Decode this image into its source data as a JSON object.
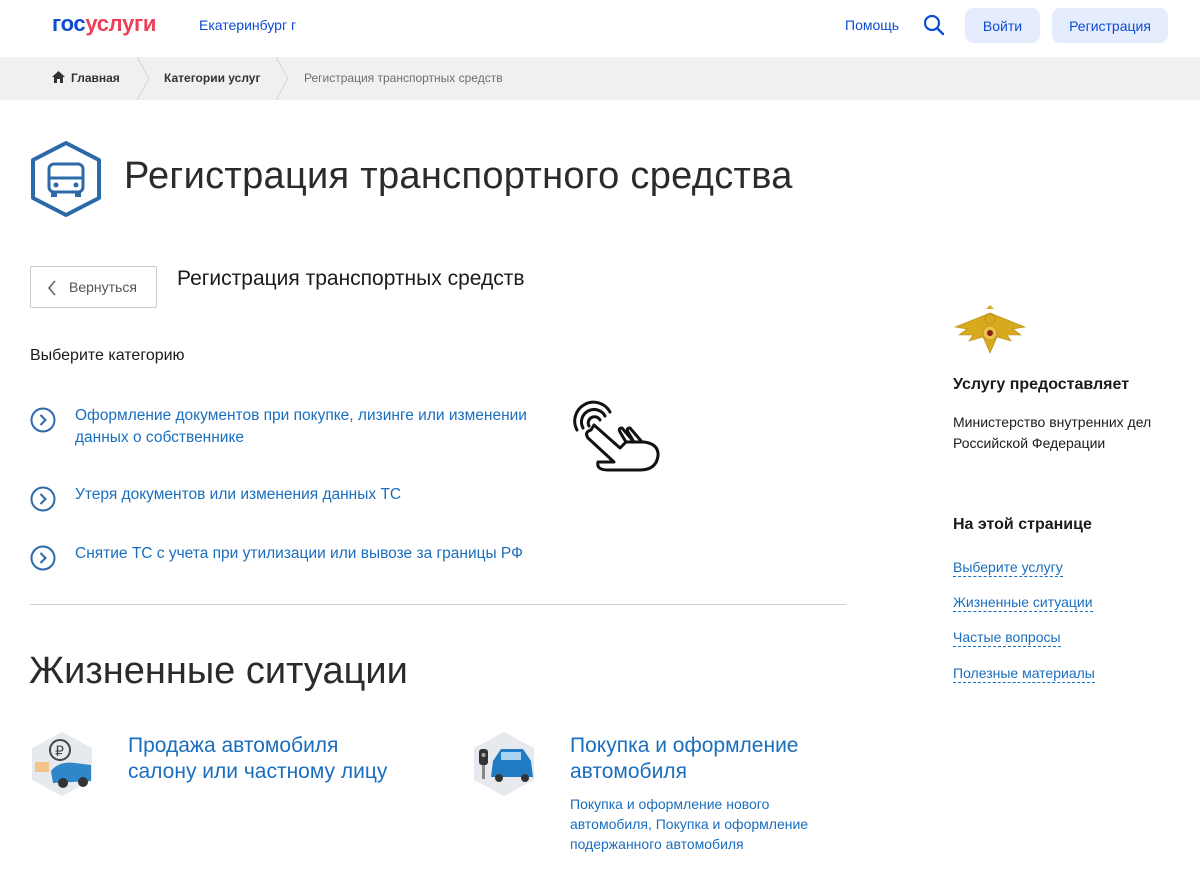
{
  "header": {
    "logo_part1": "гос",
    "logo_part2": "услуги",
    "city": "Екатеринбург г",
    "help": "Помощь",
    "login": "Войти",
    "register": "Регистрация"
  },
  "breadcrumbs": [
    "Главная",
    "Категории услуг",
    "Регистрация транспортных средств"
  ],
  "page": {
    "title": "Регистрация транспортного средства",
    "back": "Вернуться",
    "subtitle": "Регистрация транспортных средств",
    "choose_label": "Выберите категорию",
    "categories": [
      {
        "line1": "Оформление документов при покупке, лизинге или изменении",
        "line2": "данных о собственнике"
      },
      {
        "line1": "Утеря документов или изменения данных ТС",
        "line2": ""
      },
      {
        "line1": "Снятие ТС с учета при утилизации или вывозе за границы РФ",
        "line2": ""
      }
    ],
    "life_title": "Жизненные ситуации",
    "situations": [
      {
        "title_line1": "Продажа автомобиля",
        "title_line2": "салону или частному лицу",
        "desc": ""
      },
      {
        "title_line1": "Покупка и оформление",
        "title_line2": "автомобиля",
        "desc_line1": "Покупка и оформление нового",
        "desc_line2": "автомобиля, Покупка и оформление",
        "desc_line3": "подержанного автомобиля"
      }
    ]
  },
  "sidebar": {
    "provider_heading": "Услугу предоставляет",
    "provider_line1": "Министерство внутренних дел",
    "provider_line2": "Российской Федерации",
    "on_page_heading": "На этой странице",
    "links": [
      "Выберите услугу",
      "Жизненные ситуации",
      "Частые вопросы",
      "Полезные материалы"
    ]
  },
  "colors": {
    "brand_blue": "#0d4cd3",
    "brand_red": "#ee3f58",
    "link_blue": "#1a6ebe",
    "icon_blue": "#2d6aa8"
  }
}
